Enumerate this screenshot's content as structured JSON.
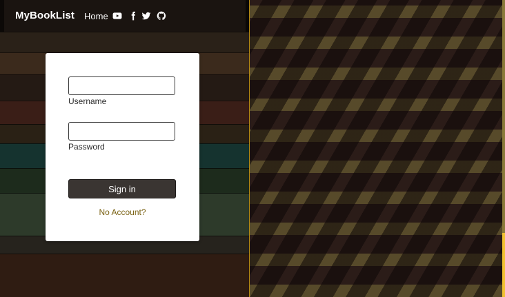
{
  "navbar": {
    "brand": "MyBookList",
    "home_label": "Home",
    "icons": [
      "youtube-icon",
      "facebook-icon",
      "twitter-icon",
      "github-icon"
    ]
  },
  "login": {
    "username_value": "",
    "username_label": "Username",
    "password_value": "",
    "password_label": "Password",
    "signin_label": "Sign in",
    "no_account_label": "No Account?"
  },
  "colors": {
    "accent": "#f1c232",
    "link": "#7b6315",
    "button": "#3a3532"
  }
}
